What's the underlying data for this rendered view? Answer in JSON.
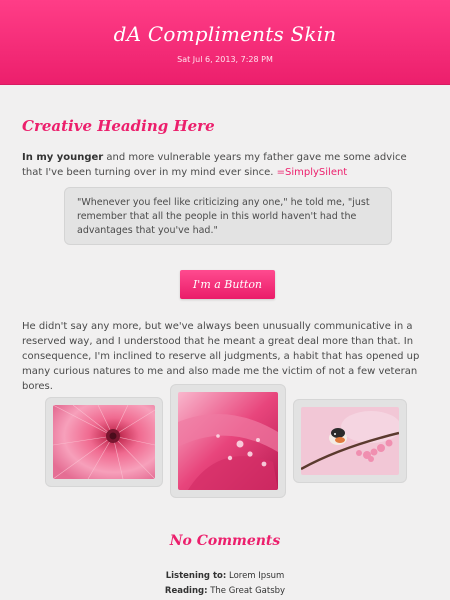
{
  "header": {
    "title": "dA Compliments Skin",
    "date": "Sat Jul 6, 2013, 7:28 PM"
  },
  "article": {
    "heading": "Creative Heading Here",
    "intro_bold": "In my younger",
    "intro_text": " and more vulnerable years my father gave me some advice that I've been turning over in my mind ever since. ",
    "intro_link": "=SimplySilent",
    "quote": "\"Whenever you feel like criticizing any one,\" he told me, \"just remember that all the people in this world haven't had the advantages that you've had.\"",
    "button_label": "I'm a Button",
    "paragraph": "He didn't say any more, but we've always been unusually communicative in a reserved way, and I understood that he meant a great deal more than that. In consequence, I'm inclined to reserve all judgments, a habit that has opened up many curious natures to me and also made me the victim of not a few veteran bores."
  },
  "gallery": {
    "items": [
      {
        "icon": "pink-gerbera-flower-photo"
      },
      {
        "icon": "pink-petals-with-water-drops-photo"
      },
      {
        "icon": "bird-on-cherry-blossom-branch-photo"
      }
    ]
  },
  "comments": {
    "title": "No Comments"
  },
  "status": {
    "listening_label": "Listening to:",
    "listening_value": "Lorem Ipsum",
    "reading_label": "Reading:",
    "reading_value": "The Great Gatsby"
  },
  "colors": {
    "accent": "#ec1f6c",
    "background": "#f1f0f0"
  }
}
